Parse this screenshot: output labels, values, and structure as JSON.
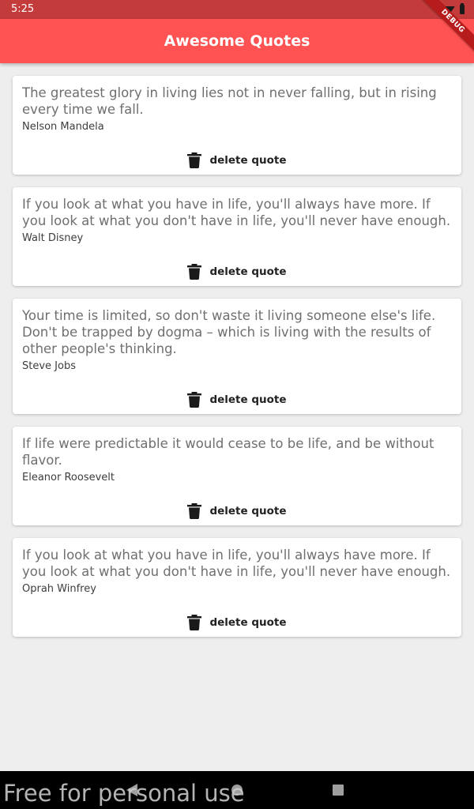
{
  "status_bar": {
    "time": "5:25"
  },
  "app_bar": {
    "title": "Awesome Quotes",
    "debug_banner": "DEBUG"
  },
  "quotes": [
    {
      "text": "The greatest glory in living lies not in never falling, but in rising every time we fall.",
      "author": "Nelson Mandela",
      "action_label": "delete quote",
      "action_icon": "trash-icon"
    },
    {
      "text": "If you look at what you have in life, you'll always have more. If you look at what you don't have in life, you'll never have enough.",
      "author": "Walt Disney",
      "action_label": "delete quote",
      "action_icon": "trash-icon"
    },
    {
      "text": "Your time is limited, so don't waste it living someone else's life. Don't be trapped by dogma – which is living with the results of other people's thinking.",
      "author": "Steve Jobs",
      "action_label": "delete quote",
      "action_icon": "trash-icon"
    },
    {
      "text": "If life were predictable it would cease to be life, and be without flavor.",
      "author": "Eleanor Roosevelt",
      "action_label": "delete quote",
      "action_icon": "trash-icon"
    },
    {
      "text": "If you look at what you have in life, you'll always have more. If you look at what you don't have in life, you'll never have enough.",
      "author": "Oprah Winfrey",
      "action_label": "delete quote",
      "action_icon": "trash-icon"
    }
  ],
  "watermark": "Free for personal use",
  "colors": {
    "app_bar": "#ff5252",
    "status_bar": "#c33b3b",
    "background": "#eeeeee",
    "card": "#ffffff",
    "debug_banner": "#b71c1c"
  }
}
